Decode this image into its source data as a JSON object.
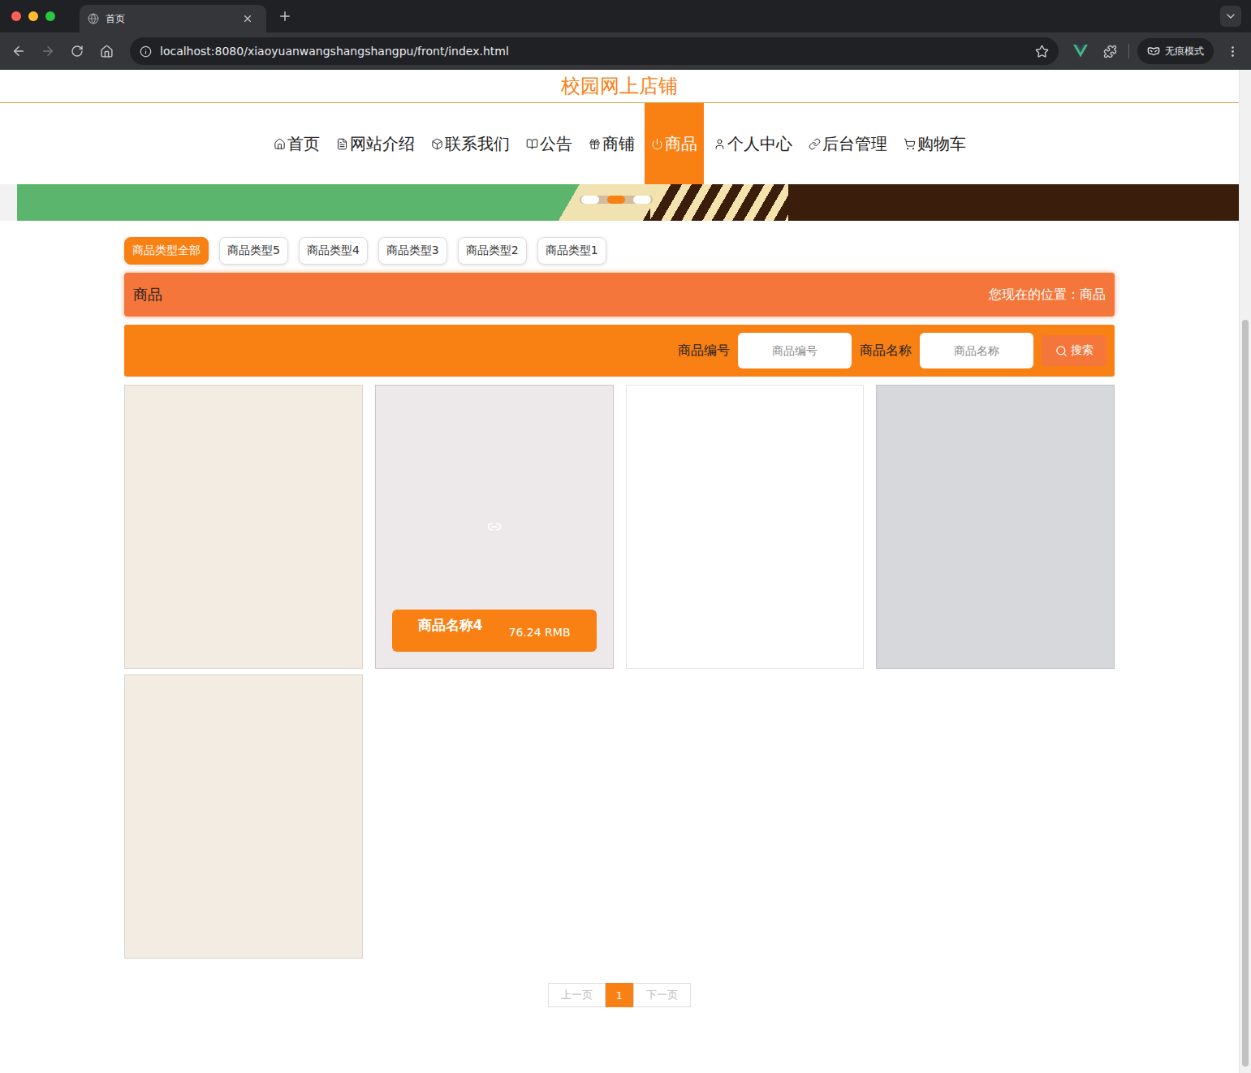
{
  "browser": {
    "tab_title": "首页",
    "url": "localhost:8080/xiaoyuanwangshangshangpu/front/index.html",
    "incognito_label": "无痕模式"
  },
  "site_title": "校园网上店铺",
  "nav": [
    {
      "label": "首页",
      "selected": false
    },
    {
      "label": "网站介绍",
      "selected": false
    },
    {
      "label": "联系我们",
      "selected": false
    },
    {
      "label": "公告",
      "selected": false
    },
    {
      "label": "商铺",
      "selected": false
    },
    {
      "label": "商品",
      "selected": true
    },
    {
      "label": "个人中心",
      "selected": false
    },
    {
      "label": "后台管理",
      "selected": false
    },
    {
      "label": "购物车",
      "selected": false
    }
  ],
  "banner": {
    "dots": [
      {
        "selected": false
      },
      {
        "selected": true
      },
      {
        "selected": false
      }
    ]
  },
  "categories": [
    {
      "label": "商品类型全部",
      "selected": true
    },
    {
      "label": "商品类型5",
      "selected": false
    },
    {
      "label": "商品类型4",
      "selected": false
    },
    {
      "label": "商品类型3",
      "selected": false
    },
    {
      "label": "商品类型2",
      "selected": false
    },
    {
      "label": "商品类型1",
      "selected": false
    }
  ],
  "section": {
    "title": "商品",
    "breadcrumb": "您现在的位置：商品"
  },
  "search": {
    "fields": [
      {
        "label": "商品编号",
        "placeholder": "商品编号"
      },
      {
        "label": "商品名称",
        "placeholder": "商品名称"
      }
    ],
    "button": "搜索"
  },
  "products": [
    {
      "hovered": false,
      "color": "#f2ece3"
    },
    {
      "hovered": true,
      "name": "商品名称4",
      "price": "76.24 RMB",
      "color": "#e3dcdd"
    },
    {
      "hovered": false,
      "color": "#ffffff"
    },
    {
      "hovered": false,
      "color": "#d6d8dc"
    },
    {
      "hovered": false,
      "color": "#f2ece3"
    }
  ],
  "pagination": {
    "prev": "上一页",
    "next": "下一页",
    "pages": [
      {
        "label": "1",
        "selected": true
      }
    ]
  }
}
